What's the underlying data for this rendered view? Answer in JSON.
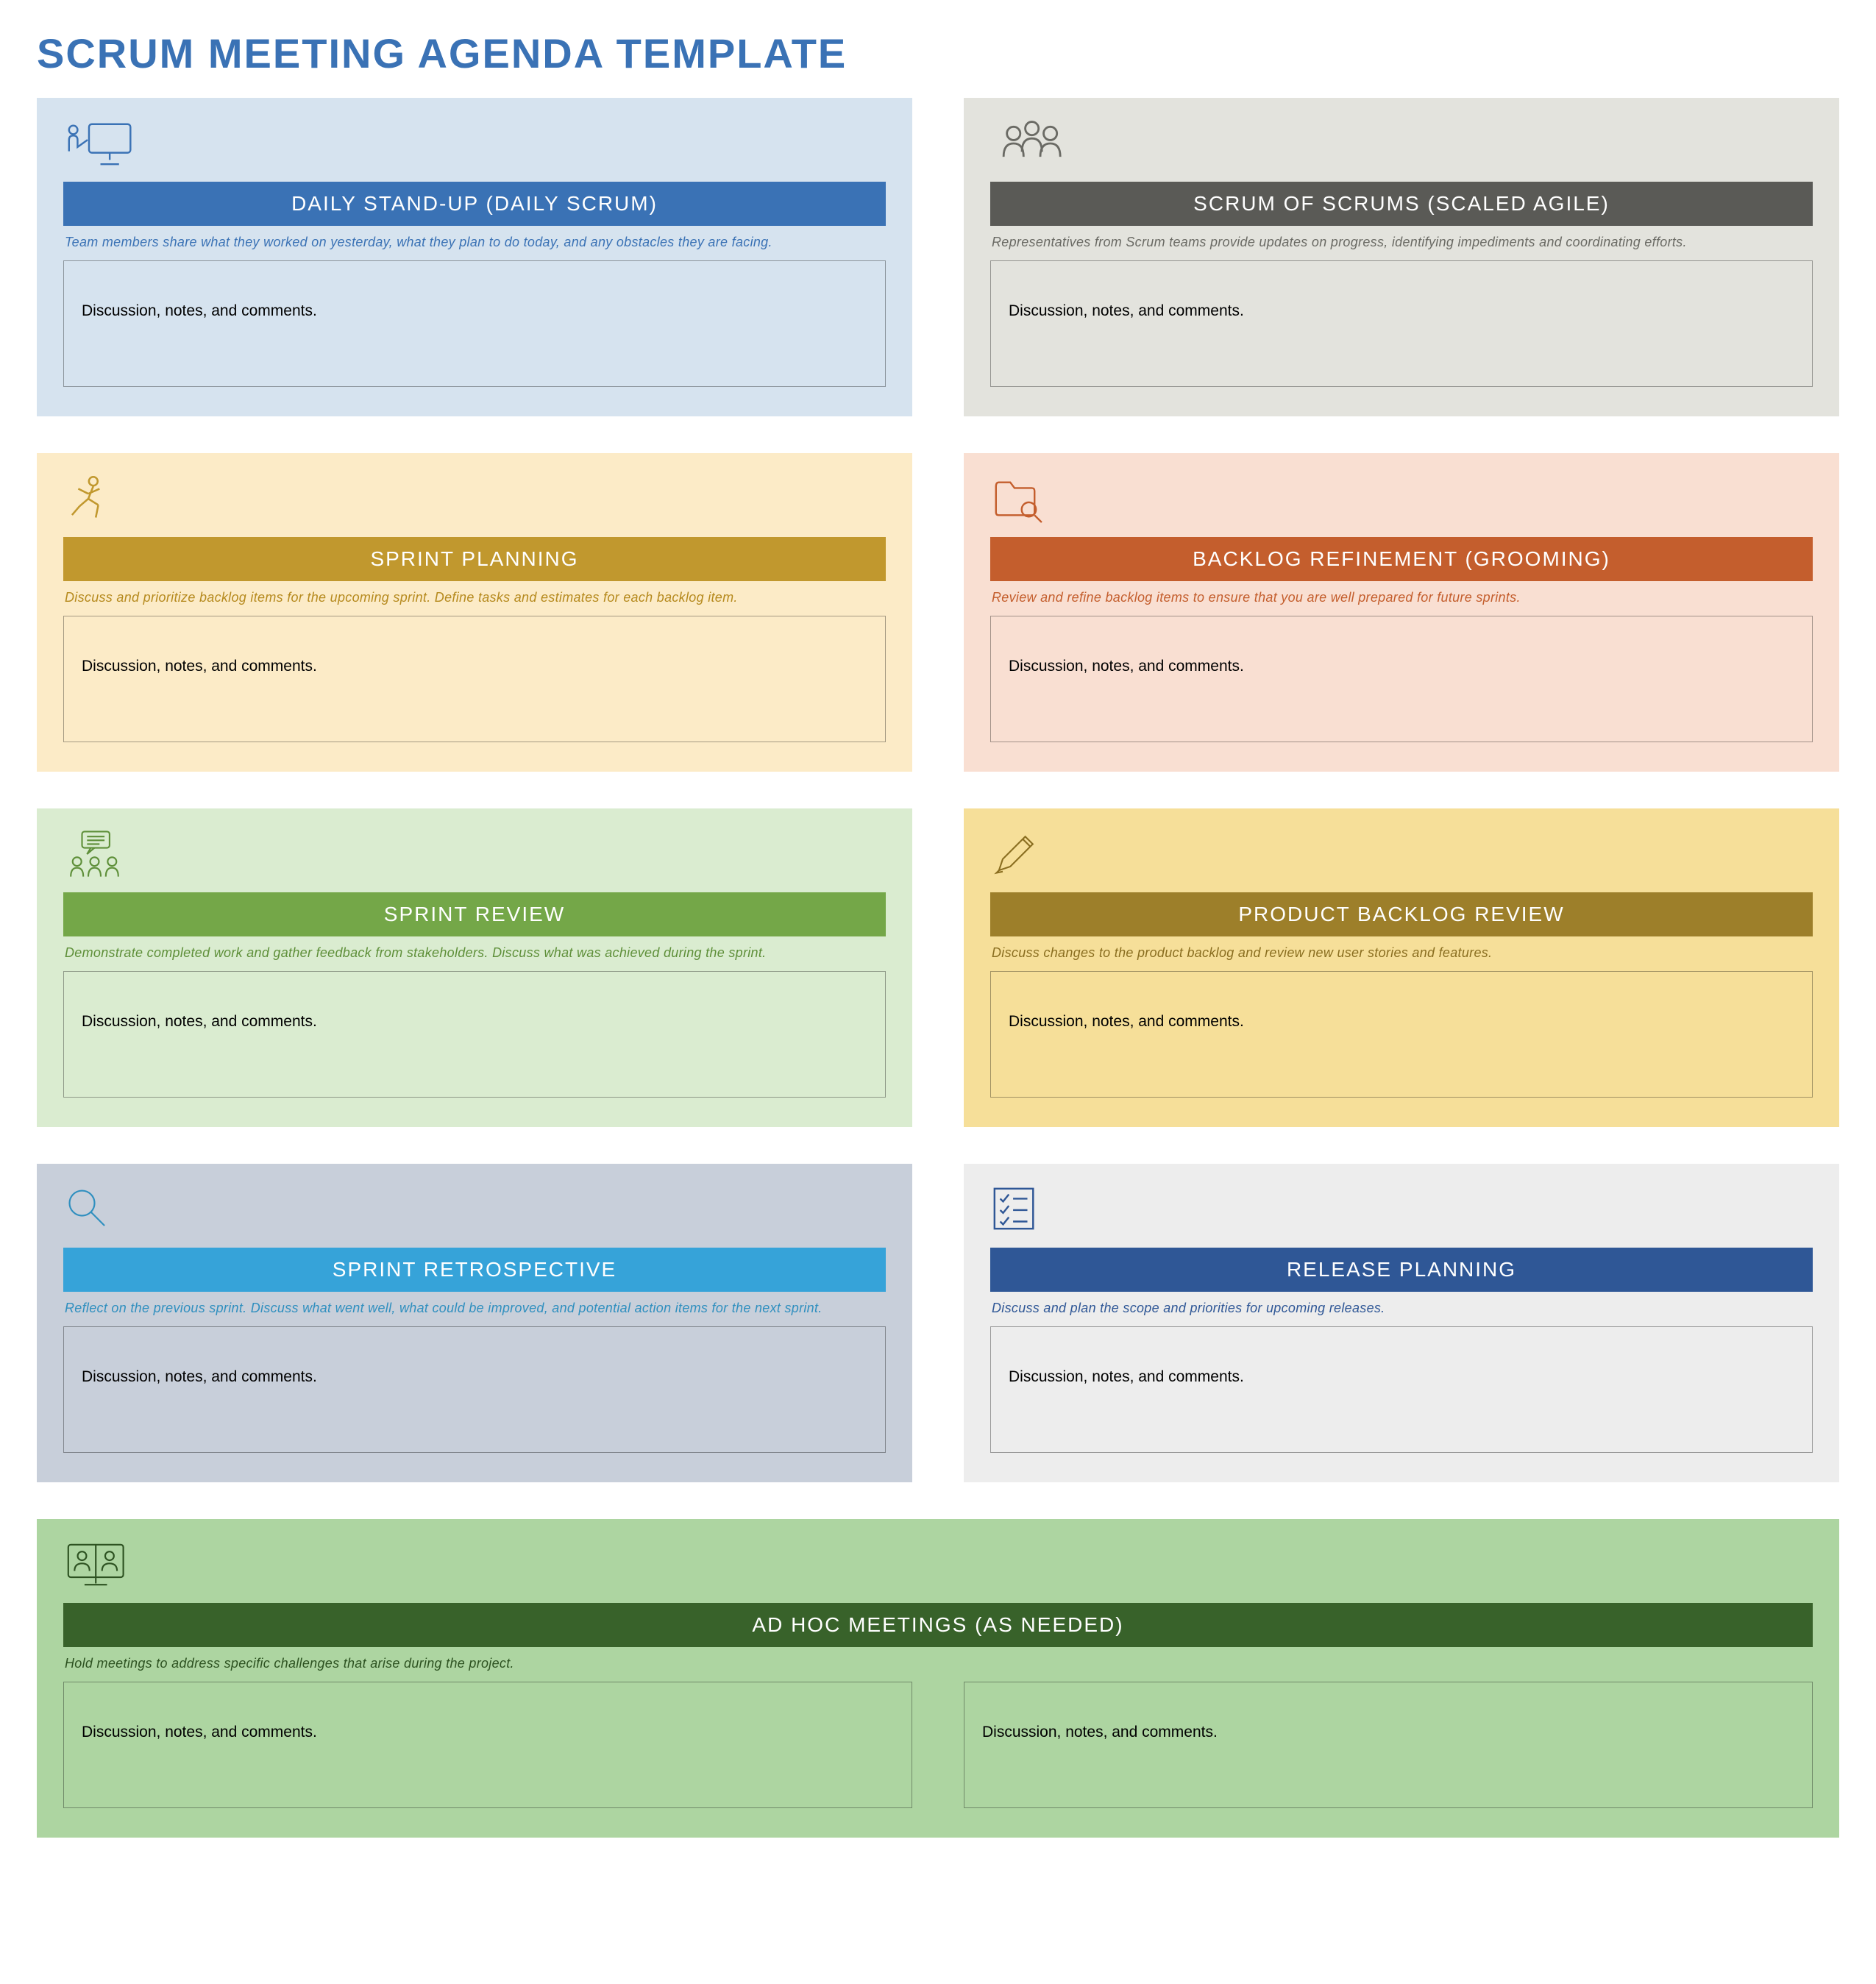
{
  "page_title": "SCRUM MEETING AGENDA TEMPLATE",
  "notes_placeholder": "Discussion, notes, and comments.",
  "cards": {
    "daily_standup": {
      "title": "DAILY STAND-UP (DAILY SCRUM)",
      "subtitle": "Team members share what they worked on yesterday, what they plan to do today, and any obstacles they are facing."
    },
    "scrum_of_scrums": {
      "title": "SCRUM OF SCRUMS (SCALED AGILE)",
      "subtitle": "Representatives from Scrum teams provide updates on progress, identifying impediments and coordinating efforts."
    },
    "sprint_planning": {
      "title": "SPRINT PLANNING",
      "subtitle": "Discuss and prioritize backlog items for the upcoming sprint. Define tasks and estimates for each backlog item."
    },
    "backlog_refinement": {
      "title": "BACKLOG REFINEMENT (GROOMING)",
      "subtitle": "Review and refine backlog items to ensure that you are well prepared for future sprints."
    },
    "sprint_review": {
      "title": "SPRINT REVIEW",
      "subtitle": "Demonstrate completed work and gather feedback from stakeholders. Discuss what was achieved during the sprint."
    },
    "product_backlog_review": {
      "title": "PRODUCT BACKLOG REVIEW",
      "subtitle": "Discuss changes to the product backlog and review new user stories and features."
    },
    "sprint_retrospective": {
      "title": "SPRINT RETROSPECTIVE",
      "subtitle": "Reflect on the previous sprint. Discuss what went well, what could be improved, and potential action items for the next sprint."
    },
    "release_planning": {
      "title": "RELEASE PLANNING",
      "subtitle": "Discuss and plan the scope and priorities for upcoming releases."
    },
    "ad_hoc": {
      "title": "AD HOC MEETINGS (AS NEEDED)",
      "subtitle": "Hold meetings to address specific challenges that arise during the project."
    }
  }
}
